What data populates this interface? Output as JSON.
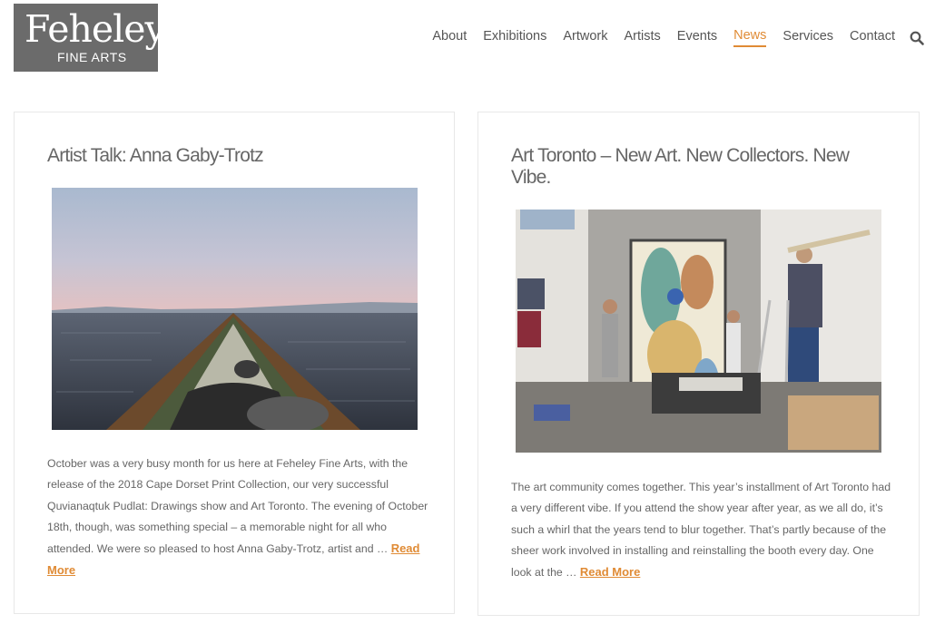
{
  "site": {
    "logo_main": "Feheley",
    "logo_sub": "FINE ARTS"
  },
  "nav": {
    "items": [
      {
        "label": "About"
      },
      {
        "label": "Exhibitions"
      },
      {
        "label": "Artwork"
      },
      {
        "label": "Artists"
      },
      {
        "label": "Events"
      },
      {
        "label": "News"
      },
      {
        "label": "Services"
      },
      {
        "label": "Contact"
      }
    ],
    "active": "News",
    "accent_color": "#e08b35"
  },
  "posts": [
    {
      "title": "Artist Talk: Anna Gaby-Trotz",
      "excerpt": "October was a very busy month for us here at Feheley Fine Arts, with the release of the 2018 Cape Dorset Print Collection, our very successful Quvianaqtuk Pudlat: Drawings show and Art Toronto. The evening of October 18th, though, was something special – a memorable night for all who attended. We were so pleased to host Anna Gaby-Trotz, artist and …",
      "read_more": "Read More"
    },
    {
      "title": "Art Toronto – New Art. New Collectors. New Vibe.",
      "excerpt": "The art community comes together.   This year’s installment of Art Toronto had a very different vibe. If you attend the show year after year, as we all do, it’s such a whirl that the years tend to blur together. That’s partly because of the sheer work involved in installing and reinstalling the booth every day. One look at the …",
      "read_more": "Read More"
    }
  ]
}
